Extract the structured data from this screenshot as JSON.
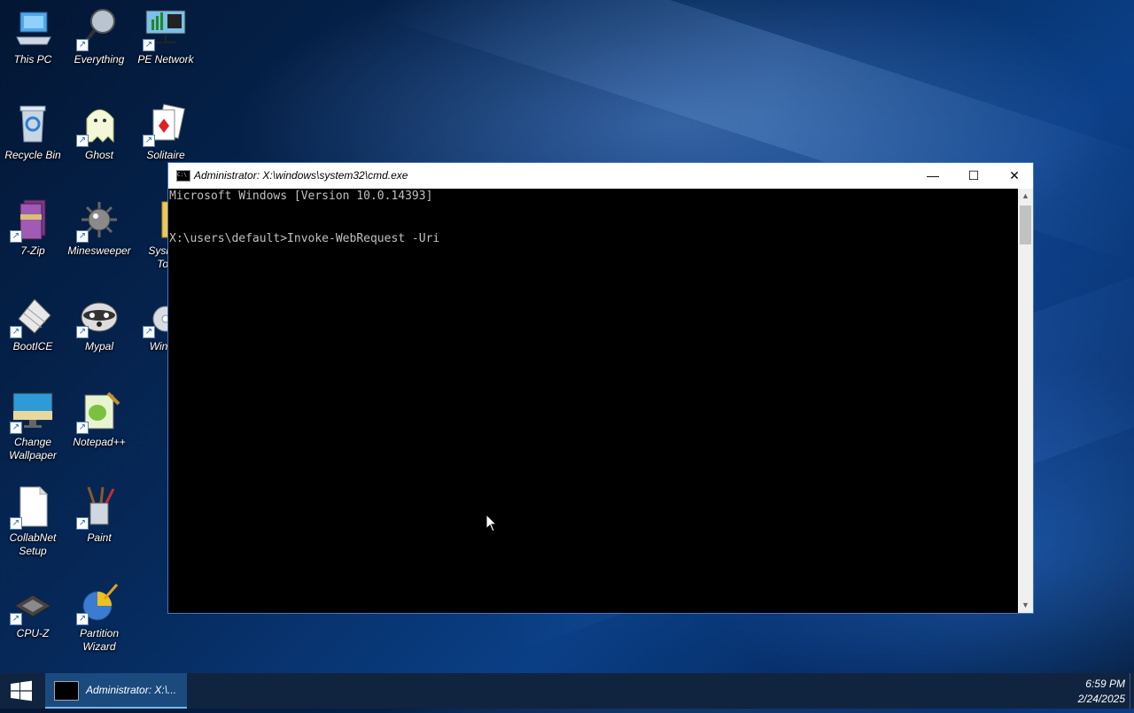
{
  "desktop": {
    "icons": {
      "this_pc": "This PC",
      "everything": "Everything",
      "pe_network": "PE Network",
      "recycle_bin": "Recycle Bin",
      "ghost": "Ghost",
      "solitaire": "Solitaire",
      "seven_zip": "7-Zip",
      "minesweeper": "Minesweeper",
      "sysinternals_line1": "Sysinte",
      "sysinternals_line2": "Too",
      "bootice": "BootICE",
      "mypal": "Mypal",
      "winnt": "WinNT",
      "change_wallpaper_line1": "Change",
      "change_wallpaper_line2": "Wallpaper",
      "notepadpp": "Notepad++",
      "collabnet_line1": "CollabNet",
      "collabnet_line2": "Setup",
      "paint": "Paint",
      "cpuz": "CPU-Z",
      "partition_line1": "Partition",
      "partition_line2": "Wizard"
    }
  },
  "cmd_window": {
    "title": "Administrator: X:\\windows\\system32\\cmd.exe",
    "lines": [
      "Microsoft Windows [Version 10.0.14393]",
      "",
      "X:\\users\\default>Invoke-WebRequest -Uri"
    ],
    "minimize_glyph": "—",
    "maximize_glyph": "☐",
    "close_glyph": "✕",
    "scroll_up_glyph": "▲",
    "scroll_down_glyph": "▼"
  },
  "taskbar": {
    "task_label": "Administrator: X:\\...",
    "time": "6:59 PM",
    "date": "2/24/2025"
  },
  "colors": {
    "taskbar_bg": "#10243f",
    "active_task": "#1b4a7e",
    "console_bg": "#000000",
    "console_text": "#c0c0c0",
    "window_border": "#3f78c8"
  }
}
